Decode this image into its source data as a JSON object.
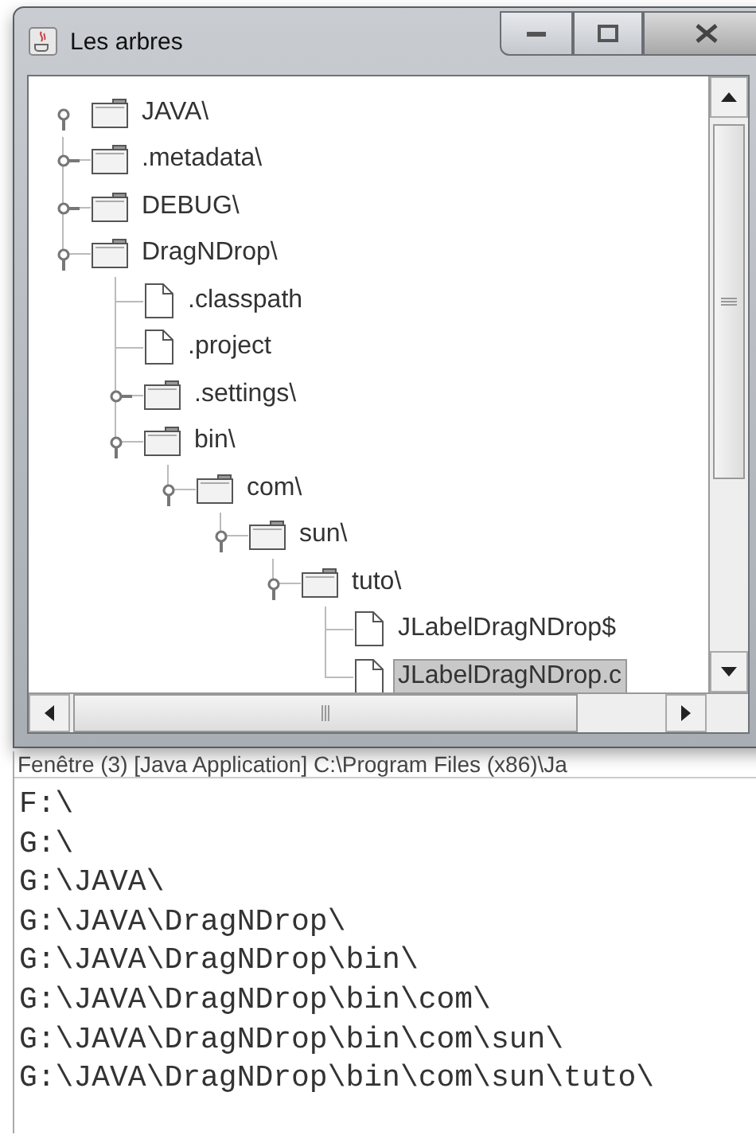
{
  "window": {
    "title": "Les arbres"
  },
  "tree": [
    {
      "label": "JAVA\\",
      "kind": "folder",
      "expanded": true,
      "selected": false,
      "children": [
        {
          "label": ".metadata\\",
          "kind": "folder",
          "expanded": false,
          "selected": false
        },
        {
          "label": "DEBUG\\",
          "kind": "folder",
          "expanded": false,
          "selected": false
        },
        {
          "label": "DragNDrop\\",
          "kind": "folder",
          "expanded": true,
          "selected": false,
          "children": [
            {
              "label": ".classpath",
              "kind": "file",
              "selected": false
            },
            {
              "label": ".project",
              "kind": "file",
              "selected": false
            },
            {
              "label": ".settings\\",
              "kind": "folder",
              "expanded": false,
              "selected": false
            },
            {
              "label": "bin\\",
              "kind": "folder",
              "expanded": true,
              "selected": false,
              "children": [
                {
                  "label": "com\\",
                  "kind": "folder",
                  "expanded": true,
                  "selected": false,
                  "children": [
                    {
                      "label": "sun\\",
                      "kind": "folder",
                      "expanded": true,
                      "selected": false,
                      "children": [
                        {
                          "label": "tuto\\",
                          "kind": "folder",
                          "expanded": true,
                          "selected": false,
                          "children": [
                            {
                              "label": "JLabelDragNDrop$",
                              "kind": "file",
                              "selected": false
                            },
                            {
                              "label": "JLabelDragNDrop.c",
                              "kind": "file",
                              "selected": true
                            }
                          ]
                        }
                      ]
                    }
                  ]
                }
              ]
            }
          ]
        }
      ]
    }
  ],
  "console": {
    "header": "Fenêtre (3) [Java Application] C:\\Program Files (x86)\\Ja",
    "lines": [
      "F:\\",
      "G:\\",
      "G:\\JAVA\\",
      "G:\\JAVA\\DragNDrop\\",
      "G:\\JAVA\\DragNDrop\\bin\\",
      "G:\\JAVA\\DragNDrop\\bin\\com\\",
      "G:\\JAVA\\DragNDrop\\bin\\com\\sun\\",
      "G:\\JAVA\\DragNDrop\\bin\\com\\sun\\tuto\\"
    ]
  }
}
